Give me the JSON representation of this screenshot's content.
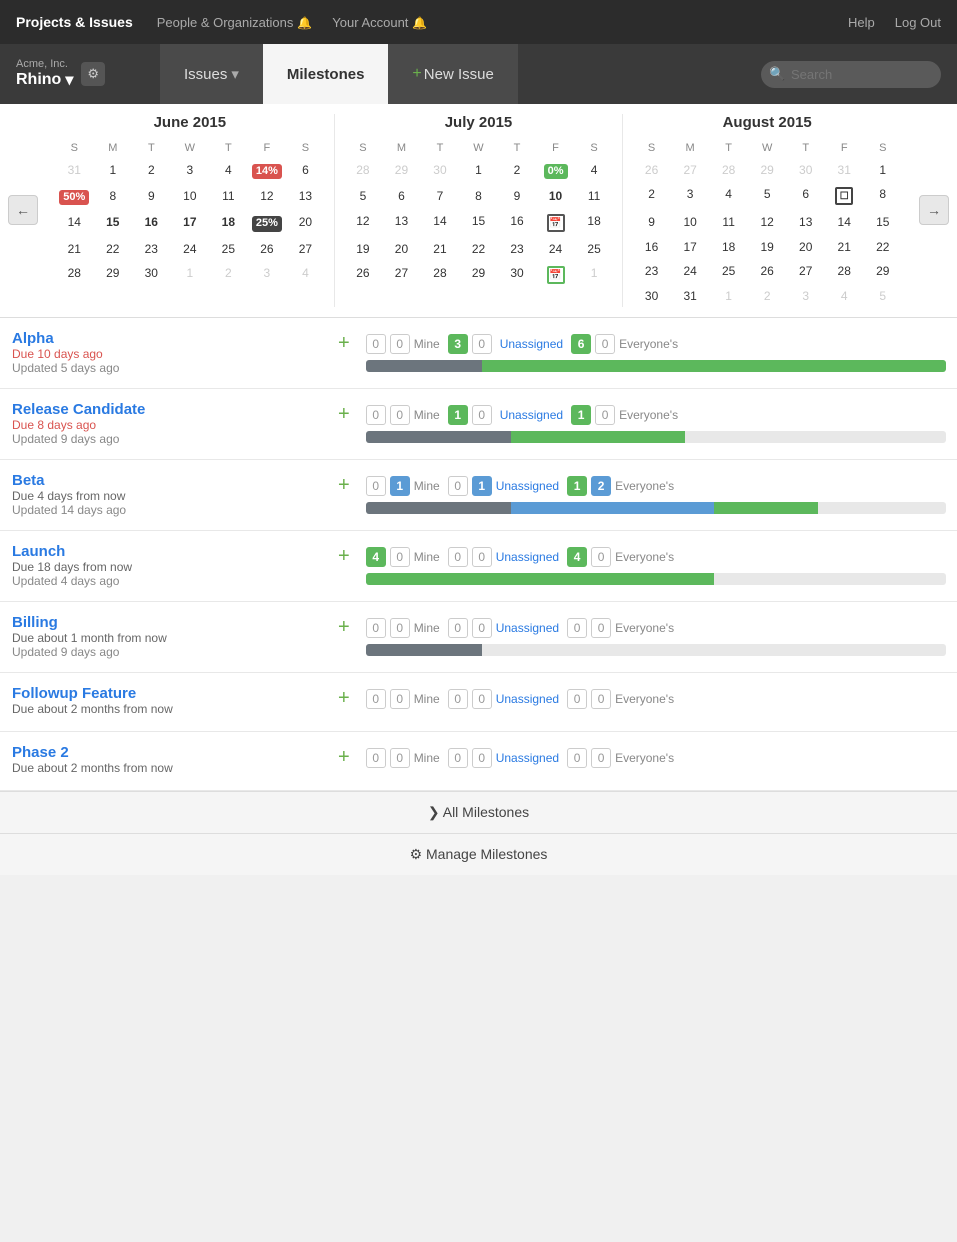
{
  "topnav": {
    "brand": "Projects & Issues",
    "links": [
      {
        "label": "People & Organizations",
        "id": "people-orgs"
      },
      {
        "label": "Your Account",
        "id": "your-account"
      }
    ],
    "right": [
      {
        "label": "Help"
      },
      {
        "label": "Log Out"
      }
    ]
  },
  "subheader": {
    "company": "Acme, Inc.",
    "project": "Rhino",
    "tabs": [
      {
        "label": "Issues",
        "id": "issues",
        "active": false,
        "dropdown": true
      },
      {
        "label": "Milestones",
        "id": "milestones",
        "active": true
      },
      {
        "label": "+ New Issue",
        "id": "new-issue",
        "active": false
      }
    ],
    "search_placeholder": "Search"
  },
  "calendar": {
    "months": [
      {
        "title": "June 2015",
        "headers": [
          "S",
          "M",
          "T",
          "W",
          "T",
          "F",
          "S"
        ],
        "weeks": [
          [
            "31",
            "1",
            "2",
            "3",
            "4",
            "14%",
            "6"
          ],
          [
            "50%",
            "8",
            "9",
            "10",
            "11",
            "12",
            "13"
          ],
          [
            "14",
            "15",
            "16",
            "17",
            "18",
            "25%",
            "20"
          ],
          [
            "21",
            "22",
            "23",
            "24",
            "25",
            "26",
            "27"
          ],
          [
            "28",
            "29",
            "30",
            "1",
            "2",
            "3",
            "4"
          ]
        ],
        "badges": {
          "14%": "red",
          "50%": "red-left",
          "25%": "dark"
        }
      },
      {
        "title": "July 2015",
        "headers": [
          "S",
          "M",
          "T",
          "W",
          "T",
          "F",
          "S"
        ],
        "weeks": [
          [
            "28",
            "29",
            "30",
            "1",
            "2",
            "0%",
            "4"
          ],
          [
            "5",
            "6",
            "7",
            "8",
            "9",
            "10",
            "11"
          ],
          [
            "12",
            "13",
            "14",
            "15",
            "16",
            "📅",
            "18"
          ],
          [
            "19",
            "20",
            "21",
            "22",
            "23",
            "24",
            "25"
          ],
          [
            "26",
            "27",
            "28",
            "29",
            "30",
            "📅",
            "1"
          ]
        ],
        "badges": {
          "0%": "green"
        }
      },
      {
        "title": "August 2015",
        "headers": [
          "S",
          "M",
          "T",
          "W",
          "T",
          "F",
          "S"
        ],
        "weeks": [
          [
            "26",
            "27",
            "28",
            "29",
            "30",
            "31",
            "1"
          ],
          [
            "2",
            "3",
            "4",
            "5",
            "6",
            "🔲",
            "8"
          ],
          [
            "9",
            "10",
            "11",
            "12",
            "13",
            "14",
            "15"
          ],
          [
            "16",
            "17",
            "18",
            "19",
            "20",
            "21",
            "22"
          ],
          [
            "23",
            "24",
            "25",
            "26",
            "27",
            "28",
            "29"
          ],
          [
            "30",
            "31",
            "1",
            "2",
            "3",
            "4",
            "5"
          ]
        ]
      }
    ]
  },
  "milestones": [
    {
      "name": "Alpha",
      "due_text": "Due 10 days ago",
      "due_class": "overdue",
      "updated_text": "Updated 5 days ago",
      "mine": {
        "open": 0,
        "closed": 0
      },
      "mine_badge": 3,
      "unassigned": {
        "open": 0,
        "closed": 0
      },
      "unassigned_badge": 0,
      "everyone": {
        "open": 6,
        "closed": 0
      },
      "everyone_badge": 6,
      "progress": {
        "done": 20,
        "open": 80
      }
    },
    {
      "name": "Release Candidate",
      "due_text": "Due 8 days ago",
      "due_class": "overdue",
      "updated_text": "Updated 9 days ago",
      "mine": {
        "open": 0,
        "closed": 0
      },
      "mine_badge": 1,
      "unassigned": {
        "open": 0,
        "closed": 0
      },
      "unassigned_badge": 1,
      "everyone": {
        "open": 1,
        "closed": 0
      },
      "everyone_badge": 1,
      "progress": {
        "done": 25,
        "open": 30
      }
    },
    {
      "name": "Beta",
      "due_text": "Due 4 days from now",
      "due_class": "future",
      "updated_text": "Updated 14 days ago",
      "mine": {
        "open": 0,
        "mine_active": 1
      },
      "mine_badge_blue": 1,
      "unassigned": {
        "open": 0,
        "unassigned_active": 1
      },
      "unassigned_badge_blue": 1,
      "everyone": {
        "open": 1,
        "closed": 2
      },
      "everyone_badge": 1,
      "everyone_badge2": 2,
      "progress": {
        "done": 25,
        "inprog": 35,
        "open": 18
      }
    },
    {
      "name": "Launch",
      "due_text": "Due 18 days from now",
      "due_class": "future",
      "updated_text": "Updated 4 days ago",
      "mine": {
        "open": 4,
        "closed": 0
      },
      "mine_badge": 4,
      "unassigned": {
        "open": 0,
        "closed": 0
      },
      "unassigned_badge": 0,
      "everyone": {
        "open": 4,
        "closed": 0
      },
      "everyone_badge": 4,
      "progress": {
        "open": 60
      }
    },
    {
      "name": "Billing",
      "due_text": "Due about 1 month from now",
      "due_class": "future",
      "updated_text": "Updated 9 days ago",
      "mine": {
        "open": 0,
        "closed": 0
      },
      "unassigned": {
        "open": 0,
        "closed": 0
      },
      "everyone": {
        "open": 0,
        "closed": 0
      },
      "progress": {
        "done": 20
      }
    },
    {
      "name": "Followup Feature",
      "due_text": "Due about 2 months from now",
      "due_class": "future",
      "updated_text": "",
      "mine": {
        "open": 0,
        "closed": 0
      },
      "unassigned": {
        "open": 0,
        "closed": 0
      },
      "everyone": {
        "open": 0,
        "closed": 0
      },
      "progress": {}
    },
    {
      "name": "Phase 2",
      "due_text": "Due about 2 months from now",
      "due_class": "future",
      "updated_text": "",
      "mine": {
        "open": 0,
        "closed": 0
      },
      "unassigned": {
        "open": 0,
        "closed": 0
      },
      "everyone": {
        "open": 0,
        "closed": 0
      },
      "progress": {}
    }
  ],
  "footer": {
    "all_milestones": "❯ All Milestones",
    "manage_milestones": "⚙ Manage Milestones"
  }
}
